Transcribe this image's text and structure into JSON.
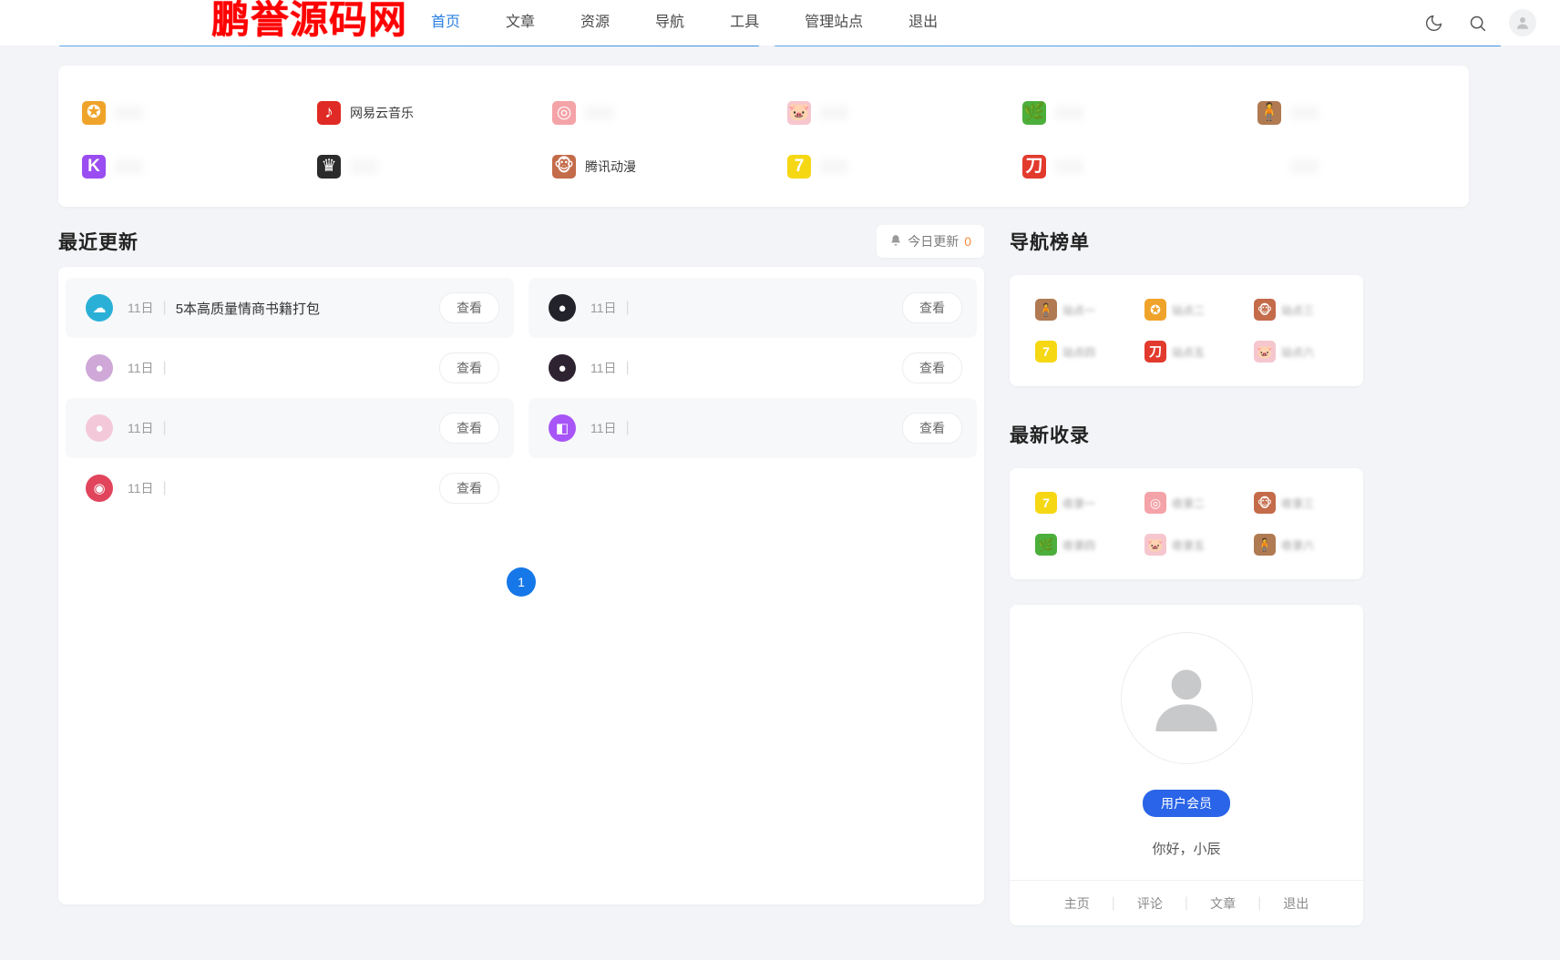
{
  "watermark": {
    "text": "鹏誉源码网",
    "color": "#ff0000"
  },
  "topnav": {
    "links": [
      {
        "label": "首页",
        "active": true
      },
      {
        "label": "文章",
        "active": false
      },
      {
        "label": "资源",
        "active": false
      },
      {
        "label": "导航",
        "active": false
      },
      {
        "label": "工具",
        "active": false
      },
      {
        "label": "管理站点",
        "active": false
      },
      {
        "label": "退出",
        "active": false
      }
    ],
    "actions": [
      {
        "name": "dark-mode-toggle",
        "icon": "moon-icon"
      },
      {
        "name": "search-button",
        "icon": "search-icon"
      },
      {
        "name": "account-avatar",
        "icon": "user-avatar-icon"
      }
    ]
  },
  "quick_links": [
    {
      "label": "",
      "hidden": true,
      "icon": "badge-check-icon",
      "color": "#f0a32a",
      "glyph": "✪"
    },
    {
      "label": "网易云音乐",
      "hidden": false,
      "icon": "netease-music-icon",
      "color": "#e02a25",
      "glyph": "♪"
    },
    {
      "label": "",
      "hidden": true,
      "icon": "target-icon",
      "color": "#f4a3a8",
      "glyph": "◎"
    },
    {
      "label": "",
      "hidden": true,
      "icon": "pig-icon",
      "color": "#f6c6cf",
      "glyph": "🐷"
    },
    {
      "label": "",
      "hidden": true,
      "icon": "leaf-icon",
      "color": "#4caf3c",
      "glyph": "🌿"
    },
    {
      "label": "",
      "hidden": true,
      "icon": "person-icon",
      "color": "#b07a52",
      "glyph": "🧍"
    },
    {
      "label": "",
      "hidden": true,
      "icon": "kuaishou-k-icon",
      "color": "#9a4df0",
      "glyph": "K"
    },
    {
      "label": "",
      "hidden": true,
      "icon": "crown-search-icon",
      "color": "#2b2b2b",
      "glyph": "♛"
    },
    {
      "label": "腾讯动漫",
      "hidden": false,
      "icon": "tencent-comic-icon",
      "color": "#c46b4a",
      "glyph": "🐵"
    },
    {
      "label": "",
      "hidden": true,
      "icon": "seven-yellow-icon",
      "color": "#f5d714",
      "glyph": "7"
    },
    {
      "label": "",
      "hidden": true,
      "icon": "xiaodao-ent-icon",
      "color": "#e23b2e",
      "glyph": "刀"
    },
    {
      "label": "",
      "hidden": true,
      "icon": "blank-icon",
      "color": "#ffffff",
      "glyph": ""
    }
  ],
  "recent": {
    "title": "最近更新",
    "today_label": "今日更新",
    "today_count": "0",
    "bell_icon": "bell-icon",
    "view_label": "查看",
    "date_sep": "|",
    "rows": [
      {
        "date": "11日",
        "title": "5本高质量情商书籍打包",
        "hidden": false,
        "shaded": true,
        "icon": "baidu-netdisk-icon",
        "color": "#2ab0d6",
        "glyph": "☁"
      },
      {
        "date": "11日",
        "title": "",
        "hidden": true,
        "shaded": true,
        "icon": "avatar-dark-icon",
        "color": "#23232b",
        "glyph": "●"
      },
      {
        "date": "11日",
        "title": "",
        "hidden": true,
        "shaded": false,
        "icon": "avatar-anime-icon",
        "color": "#cfa8d8",
        "glyph": "●"
      },
      {
        "date": "11日",
        "title": "",
        "hidden": true,
        "shaded": false,
        "icon": "avatar-dark2-icon",
        "color": "#2e2330",
        "glyph": "●"
      },
      {
        "date": "11日",
        "title": "",
        "hidden": true,
        "shaded": true,
        "icon": "avatar-pink-icon",
        "color": "#f3c8d8",
        "glyph": "●"
      },
      {
        "date": "11日",
        "title": "",
        "hidden": true,
        "shaded": true,
        "icon": "photo-app-icon",
        "color": "#a855f7",
        "glyph": "◧"
      },
      {
        "date": "11日",
        "title": "",
        "hidden": true,
        "shaded": false,
        "icon": "avatar-red-icon",
        "color": "#e0455c",
        "glyph": "◉"
      }
    ],
    "pagination": {
      "current": "1"
    }
  },
  "sidebar": {
    "ranking": {
      "title": "导航榜单",
      "items": [
        {
          "label": "站点一",
          "icon": "person-icon",
          "color": "#b07a52",
          "glyph": "🧍"
        },
        {
          "label": "站点二",
          "icon": "badge-check-icon",
          "color": "#f0a32a",
          "glyph": "✪"
        },
        {
          "label": "站点三",
          "icon": "tencent-comic-icon",
          "color": "#c46b4a",
          "glyph": "🐵"
        },
        {
          "label": "站点四",
          "icon": "seven-yellow-icon",
          "color": "#f5d714",
          "glyph": "7"
        },
        {
          "label": "站点五",
          "icon": "xiaodao-ent-icon",
          "color": "#e23b2e",
          "glyph": "刀"
        },
        {
          "label": "站点六",
          "icon": "pig-icon",
          "color": "#f6c6cf",
          "glyph": "🐷"
        }
      ]
    },
    "latest": {
      "title": "最新收录",
      "items": [
        {
          "label": "收录一",
          "icon": "seven-yellow-icon",
          "color": "#f5d714",
          "glyph": "7"
        },
        {
          "label": "收录二",
          "icon": "target-icon",
          "color": "#f4a3a8",
          "glyph": "◎"
        },
        {
          "label": "收录三",
          "icon": "tencent-comic-icon",
          "color": "#c46b4a",
          "glyph": "🐵"
        },
        {
          "label": "收录四",
          "icon": "leaf-icon",
          "color": "#4caf3c",
          "glyph": "🌿"
        },
        {
          "label": "收录五",
          "icon": "pig-icon",
          "color": "#f6c6cf",
          "glyph": "🐷"
        },
        {
          "label": "收录六",
          "icon": "person-icon",
          "color": "#b07a52",
          "glyph": "🧍"
        }
      ]
    },
    "profile": {
      "avatar_icon": "user-avatar-placeholder-icon",
      "badge": "用户会员",
      "badge_color": "#2a64e8",
      "greeting": "你好，小辰",
      "links": [
        "主页",
        "评论",
        "文章",
        "退出"
      ],
      "divider": "|"
    }
  }
}
